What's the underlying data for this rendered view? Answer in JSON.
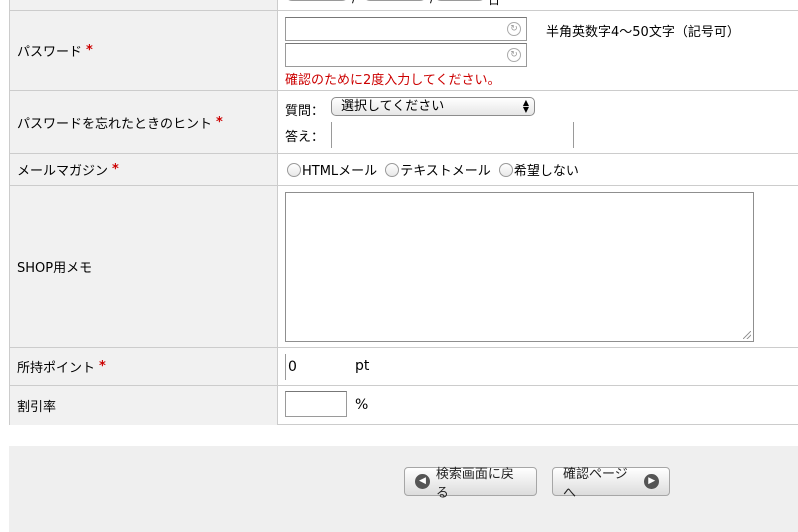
{
  "top_partial": {
    "sep1": "/",
    "sep2": "/",
    "sep3": "日"
  },
  "password": {
    "label": "パスワード",
    "required_mark": "*",
    "input_icon": "↻",
    "confirm_icon": "↻",
    "note": "半角英数字4〜50文字（記号可）",
    "warning": "確認のために2度入力してください。"
  },
  "hint": {
    "label": "パスワードを忘れたときのヒント",
    "required_mark": "*",
    "question_label": "質問：",
    "select_value": "選択してください",
    "answer_label": "答え："
  },
  "mail_magazine": {
    "label": "メールマガジン",
    "required_mark": "*",
    "options": [
      "HTMLメール",
      "テキストメール",
      "希望しない"
    ]
  },
  "shop_memo": {
    "label": "SHOP用メモ"
  },
  "points": {
    "label": "所持ポイント",
    "required_mark": "*",
    "value": "0",
    "unit": "pt"
  },
  "discount": {
    "label": "割引率",
    "unit": "%"
  },
  "actions": {
    "back_label": "検索画面に戻る",
    "back_icon": "◀",
    "confirm_label": "確認ページへ",
    "confirm_icon": "▶"
  },
  "colors": {
    "required": "#cc0000",
    "label_bg": "#f1f1f1",
    "border": "#cccccc"
  }
}
